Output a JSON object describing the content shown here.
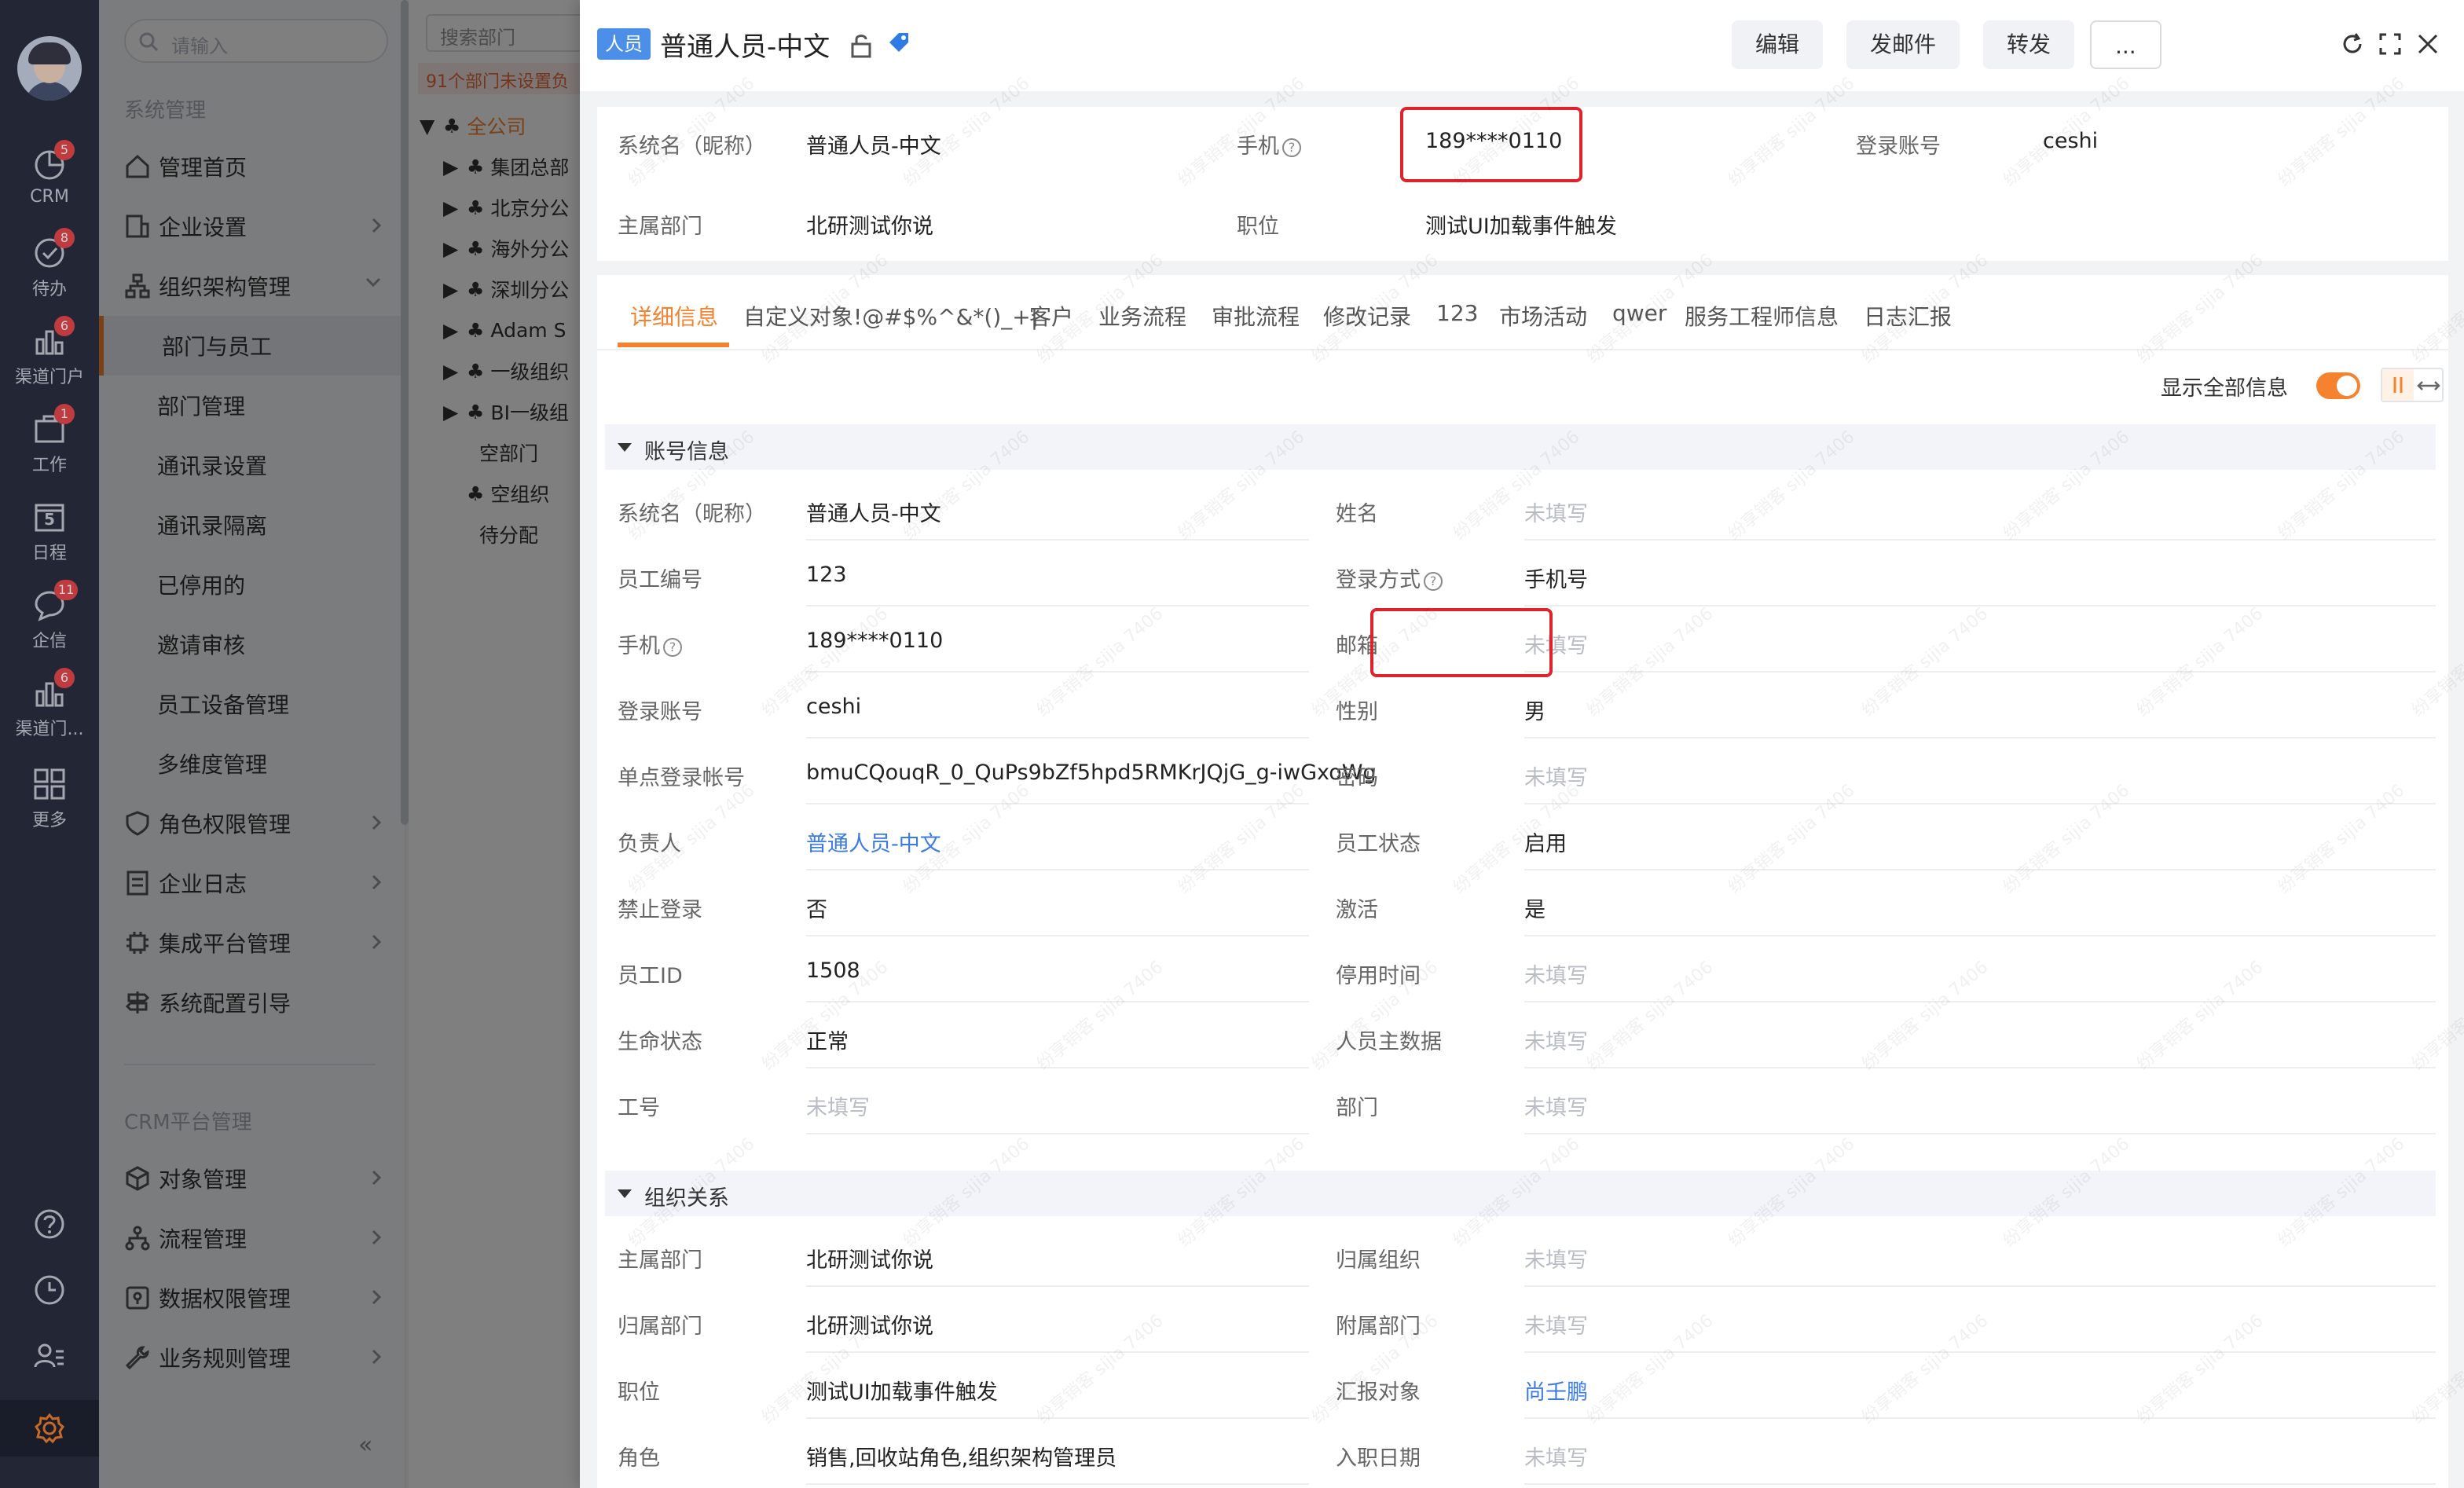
{
  "rail": {
    "items": [
      {
        "label": "CRM",
        "badge": "5"
      },
      {
        "label": "待办",
        "badge": "8"
      },
      {
        "label": "渠道门户",
        "badge": "6"
      },
      {
        "label": "工作",
        "badge": "1"
      },
      {
        "label": "日程",
        "badge": "",
        "day": "5"
      },
      {
        "label": "企信",
        "badge": "11"
      },
      {
        "label": "渠道门...",
        "badge": "6"
      },
      {
        "label": "更多",
        "badge": ""
      }
    ]
  },
  "nav": {
    "search_placeholder": "请输入",
    "section1": "系统管理",
    "items": [
      {
        "label": "管理首页"
      },
      {
        "label": "企业设置"
      },
      {
        "label": "组织架构管理"
      },
      {
        "label": "部门与员工"
      },
      {
        "label": "部门管理"
      },
      {
        "label": "通讯录设置"
      },
      {
        "label": "通讯录隔离"
      },
      {
        "label": "已停用的"
      },
      {
        "label": "邀请审核"
      },
      {
        "label": "员工设备管理"
      },
      {
        "label": "多维度管理"
      },
      {
        "label": "角色权限管理"
      },
      {
        "label": "企业日志"
      },
      {
        "label": "集成平台管理"
      },
      {
        "label": "系统配置引导"
      }
    ],
    "section2": "CRM平台管理",
    "items2": [
      {
        "label": "对象管理"
      },
      {
        "label": "流程管理"
      },
      {
        "label": "数据权限管理"
      },
      {
        "label": "业务规则管理"
      }
    ],
    "collapse": "«"
  },
  "tree": {
    "search_placeholder": "搜索部门",
    "warning": "91个部门未设置负",
    "rows": [
      "全公司",
      "集团总部",
      "北京分公",
      "海外分公",
      "深圳分公",
      "Adam S",
      "一级组织",
      "BI一级组",
      "空部门",
      "空组织",
      "待分配"
    ]
  },
  "panel": {
    "tag": "人员",
    "title": "普通人员-中文",
    "buttons": {
      "edit": "编辑",
      "mail": "发邮件",
      "forward": "转发",
      "more": "..."
    }
  },
  "summary": {
    "name_label": "系统名（昵称）",
    "name_value": "普通人员-中文",
    "phone_label": "手机",
    "phone_value": "189****0110",
    "account_label": "登录账号",
    "account_value": "ceshi",
    "dept_label": "主属部门",
    "dept_value": "北研测试你说",
    "position_label": "职位",
    "position_value": "测试UI加载事件触发"
  },
  "tabs": [
    "详细信息",
    "自定义对象!@#$%^&*()_+|",
    "客户",
    "业务流程",
    "审批流程",
    "修改记录",
    "123",
    "市场活动",
    "qwer",
    "服务工程师信息",
    "日志汇报"
  ],
  "toggle_label": "显示全部信息",
  "account_section": {
    "title": "账号信息",
    "left": [
      {
        "label": "系统名（昵称）",
        "value": "普通人员-中文",
        "style": ""
      },
      {
        "label": "员工编号",
        "value": "123",
        "style": ""
      },
      {
        "label": "手机",
        "value": "189****0110",
        "style": "",
        "help": "?"
      },
      {
        "label": "登录账号",
        "value": "ceshi",
        "style": ""
      },
      {
        "label": "单点登录帐号",
        "value": "bmuCQouqR_0_QuPs9bZf5hpd5RMKrJQjG_g-iwGxoWg",
        "style": ""
      },
      {
        "label": "负责人",
        "value": "普通人员-中文",
        "style": "link"
      },
      {
        "label": "禁止登录",
        "value": "否",
        "style": ""
      },
      {
        "label": "员工ID",
        "value": "1508",
        "style": ""
      },
      {
        "label": "生命状态",
        "value": "正常",
        "style": ""
      },
      {
        "label": "工号",
        "value": "未填写",
        "style": "empty"
      }
    ],
    "right": [
      {
        "label": "姓名",
        "value": "未填写",
        "style": "empty"
      },
      {
        "label": "登录方式",
        "value": "手机号",
        "style": "",
        "help": "?"
      },
      {
        "label": "邮箱",
        "value": "未填写",
        "style": "empty"
      },
      {
        "label": "性别",
        "value": "男",
        "style": ""
      },
      {
        "label": "密码",
        "value": "未填写",
        "style": "empty"
      },
      {
        "label": "员工状态",
        "value": "启用",
        "style": ""
      },
      {
        "label": "激活",
        "value": "是",
        "style": ""
      },
      {
        "label": "停用时间",
        "value": "未填写",
        "style": "empty"
      },
      {
        "label": "人员主数据",
        "value": "未填写",
        "style": "empty"
      },
      {
        "label": "部门",
        "value": "未填写",
        "style": "empty"
      }
    ]
  },
  "org_section": {
    "title": "组织关系",
    "left": [
      {
        "label": "主属部门",
        "value": "北研测试你说",
        "style": ""
      },
      {
        "label": "归属部门",
        "value": "北研测试你说",
        "style": ""
      },
      {
        "label": "职位",
        "value": "测试UI加载事件触发",
        "style": ""
      },
      {
        "label": "角色",
        "value": "销售,回收站角色,组织架构管理员",
        "style": ""
      }
    ],
    "right": [
      {
        "label": "归属组织",
        "value": "未填写",
        "style": "empty"
      },
      {
        "label": "附属部门",
        "value": "未填写",
        "style": "empty"
      },
      {
        "label": "汇报对象",
        "value": "尚壬鹏",
        "style": "link"
      },
      {
        "label": "入职日期",
        "value": "未填写",
        "style": "empty"
      }
    ]
  },
  "watermark": "纷享销客 sijia 7406",
  "colors": {
    "accent": "#f5822f",
    "link": "#3a7be3",
    "highlight": "#e0222c",
    "rail": "#2b3041"
  }
}
